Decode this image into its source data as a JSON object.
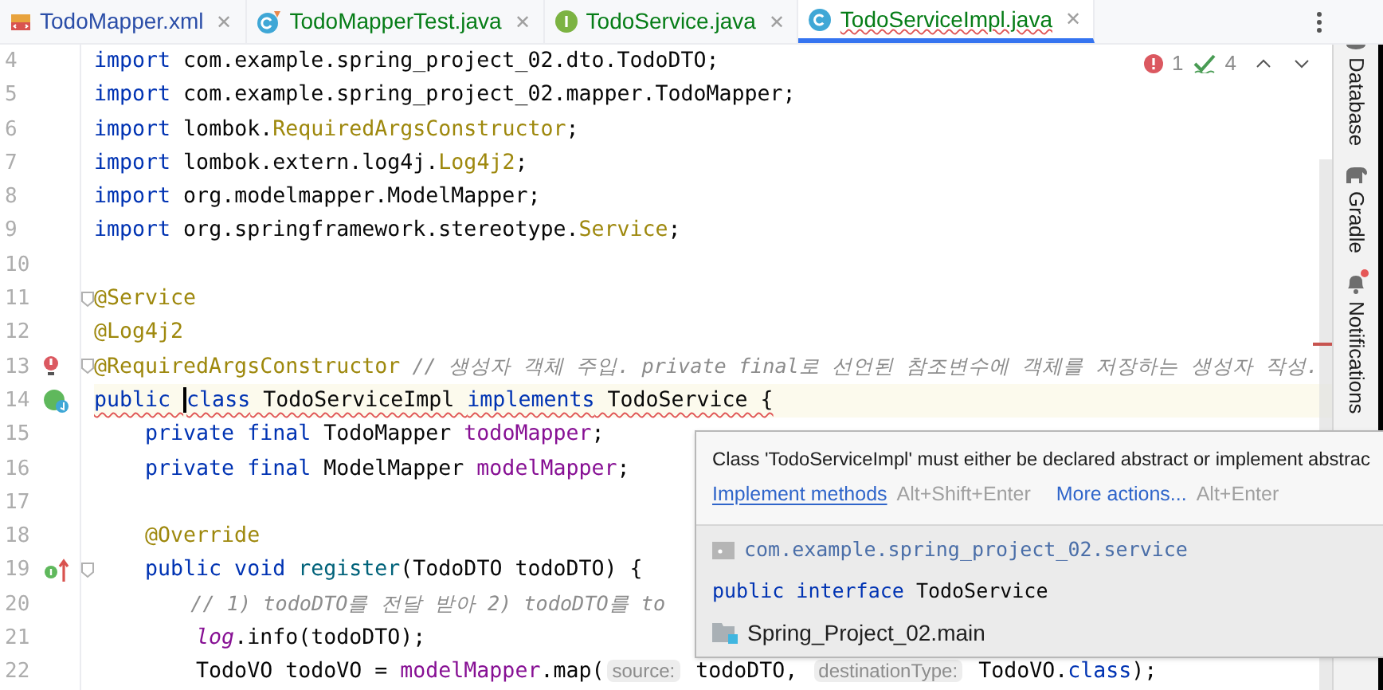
{
  "tabs": [
    {
      "label": "TodoMapper.xml",
      "kind": "xml",
      "close": "✕",
      "selected": false,
      "error": false
    },
    {
      "label": "TodoMapperTest.java",
      "kind": "test",
      "close": "✕",
      "selected": false,
      "error": false
    },
    {
      "label": "TodoService.java",
      "kind": "interface",
      "close": "✕",
      "selected": false,
      "error": false
    },
    {
      "label": "TodoServiceImpl.java",
      "kind": "class",
      "close": "✕",
      "selected": true,
      "error": true
    }
  ],
  "inspections": {
    "errors": "1",
    "warnings": "4"
  },
  "editor": {
    "lines": [
      {
        "number": "4",
        "kind": "plain",
        "current": false,
        "error": false,
        "fold": false,
        "tokens": [
          {
            "kind": "kw",
            "text": "import"
          },
          {
            "kind": "plain",
            "text": " com.example.spring_project_02.dto.TodoDTO;"
          }
        ]
      },
      {
        "number": "5",
        "kind": "plain",
        "current": false,
        "error": false,
        "fold": false,
        "tokens": [
          {
            "kind": "kw",
            "text": "import"
          },
          {
            "kind": "plain",
            "text": " com.example.spring_project_02.mapper.TodoMapper;"
          }
        ]
      },
      {
        "number": "6",
        "kind": "plain",
        "current": false,
        "error": false,
        "fold": false,
        "tokens": [
          {
            "kind": "kw",
            "text": "import"
          },
          {
            "kind": "plain",
            "text": " lombok."
          },
          {
            "kind": "ann",
            "text": "RequiredArgsConstructor"
          },
          {
            "kind": "plain",
            "text": ";"
          }
        ]
      },
      {
        "number": "7",
        "kind": "plain",
        "current": false,
        "error": false,
        "fold": false,
        "tokens": [
          {
            "kind": "kw",
            "text": "import"
          },
          {
            "kind": "plain",
            "text": " lombok.extern.log4j."
          },
          {
            "kind": "ann",
            "text": "Log4j2"
          },
          {
            "kind": "plain",
            "text": ";"
          }
        ]
      },
      {
        "number": "8",
        "kind": "plain",
        "current": false,
        "error": false,
        "fold": false,
        "tokens": [
          {
            "kind": "kw",
            "text": "import"
          },
          {
            "kind": "plain",
            "text": " org.modelmapper.ModelMapper;"
          }
        ]
      },
      {
        "number": "9",
        "kind": "plain",
        "current": false,
        "error": false,
        "fold": false,
        "tokens": [
          {
            "kind": "kw",
            "text": "import"
          },
          {
            "kind": "plain",
            "text": " org.springframework.stereotype."
          },
          {
            "kind": "ann",
            "text": "Service"
          },
          {
            "kind": "plain",
            "text": ";"
          }
        ]
      },
      {
        "number": "10",
        "kind": "plain",
        "current": false,
        "error": false,
        "fold": false
      },
      {
        "number": "11",
        "kind": "plain",
        "current": false,
        "error": false,
        "fold": true,
        "tokens": [
          {
            "kind": "ann",
            "text": "@Service"
          }
        ]
      },
      {
        "number": "12",
        "kind": "plain",
        "current": false,
        "error": false,
        "fold": false,
        "tokens": [
          {
            "kind": "ann",
            "text": "@Log4j2"
          }
        ]
      },
      {
        "number": "13",
        "kind": "bulb",
        "current": false,
        "error": false,
        "fold": true,
        "tokens": [
          {
            "kind": "ann",
            "text": "@RequiredArgsConstructor"
          },
          {
            "kind": "cmt",
            "text": " // 생성자 객체 주입. private final로 선언된 참조변수에 객체를 저장하는 생성자 작성."
          }
        ]
      },
      {
        "number": "14",
        "kind": "implemented",
        "current": true,
        "error": true,
        "fold": false,
        "tokens": [
          {
            "kind": "kw",
            "text": "public "
          },
          {
            "kind": "caret"
          },
          {
            "kind": "kw",
            "text": "class"
          },
          {
            "kind": "plain",
            "text": " TodoServiceImpl "
          },
          {
            "kind": "kw",
            "text": "implements"
          },
          {
            "kind": "plain",
            "text": " TodoService {"
          }
        ]
      },
      {
        "number": "15",
        "kind": "plain",
        "current": false,
        "error": false,
        "fold": false,
        "tokens": [
          {
            "kind": "kw",
            "text": "    private final"
          },
          {
            "kind": "plain",
            "text": " TodoMapper "
          },
          {
            "kind": "field",
            "text": "todoMapper"
          },
          {
            "kind": "plain",
            "text": ";"
          }
        ]
      },
      {
        "number": "16",
        "kind": "plain",
        "current": false,
        "error": false,
        "fold": false,
        "tokens": [
          {
            "kind": "kw",
            "text": "    private final"
          },
          {
            "kind": "plain",
            "text": " ModelMapper "
          },
          {
            "kind": "field",
            "text": "modelMapper"
          },
          {
            "kind": "plain",
            "text": ";"
          }
        ]
      },
      {
        "number": "17",
        "kind": "plain",
        "current": false,
        "error": false,
        "fold": false
      },
      {
        "number": "18",
        "kind": "plain",
        "current": false,
        "error": false,
        "fold": false,
        "tokens": [
          {
            "kind": "ann",
            "text": "    @Override"
          }
        ]
      },
      {
        "number": "19",
        "kind": "implements",
        "current": false,
        "error": false,
        "fold": true,
        "tokens": [
          {
            "kind": "kw",
            "text": "    public void"
          },
          {
            "kind": "method",
            "text": " register"
          },
          {
            "kind": "plain",
            "text": "(TodoDTO todoDTO) {"
          }
        ]
      },
      {
        "number": "20",
        "kind": "plain",
        "current": false,
        "error": false,
        "fold": false,
        "tokens": [
          {
            "kind": "cmt",
            "text": "        // 1) todoDTO를 전달 받아 2) todoDTO를 to"
          }
        ]
      },
      {
        "number": "21",
        "kind": "plain",
        "current": false,
        "error": false,
        "fold": false,
        "tokens": [
          {
            "kind": "static",
            "text": "        log"
          },
          {
            "kind": "plain",
            "text": ".info(todoDTO);"
          }
        ]
      },
      {
        "number": "22",
        "kind": "plain",
        "current": false,
        "error": false,
        "fold": false,
        "tokens": [
          {
            "kind": "plain",
            "text": "        TodoVO todoVO = "
          },
          {
            "kind": "field",
            "text": "modelMapper"
          },
          {
            "kind": "plain",
            "text": ".map("
          },
          {
            "kind": "hint",
            "text": "source:"
          },
          {
            "kind": "plain",
            "text": " todoDTO, "
          },
          {
            "kind": "hint",
            "text": "destinationType:"
          },
          {
            "kind": "plain",
            "text": " TodoVO."
          },
          {
            "kind": "kw",
            "text": "class"
          },
          {
            "kind": "plain",
            "text": ");"
          }
        ]
      }
    ]
  },
  "popup": {
    "message": "Class 'TodoServiceImpl' must either be declared abstract or implement abstrac",
    "actions": [
      {
        "label": "Implement methods",
        "shortcut": "Alt+Shift+Enter",
        "primary": true
      },
      {
        "label": "More actions...",
        "shortcut": "Alt+Enter",
        "primary": false
      }
    ],
    "package": "com.example.spring_project_02.service",
    "declaration": [
      {
        "kind": "kw",
        "text": "public interface"
      },
      {
        "kind": "plain",
        "text": " TodoService"
      }
    ],
    "module": "Spring_Project_02.main"
  },
  "tool_strip": [
    {
      "label": "Database",
      "kind": "database",
      "badge": false
    },
    {
      "label": "Gradle",
      "kind": "elephant",
      "badge": false
    },
    {
      "label": "Notifications",
      "kind": "bell",
      "badge": true
    }
  ]
}
